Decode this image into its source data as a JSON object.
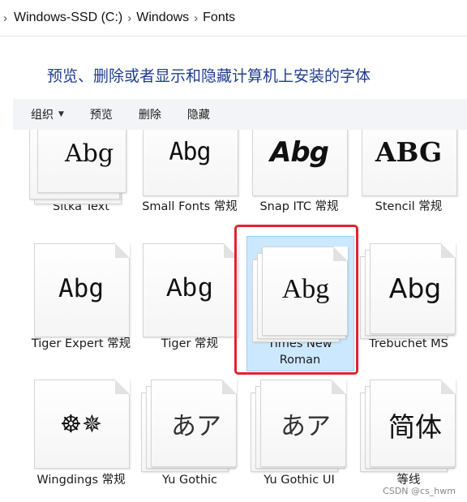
{
  "breadcrumb": {
    "items": [
      "Windows-SSD (C:)",
      "Windows",
      "Fonts"
    ]
  },
  "header": {
    "title": "预览、删除或者显示和隐藏计算机上安装的字体"
  },
  "toolbar": {
    "organize": "组织",
    "preview": "预览",
    "delete": "删除",
    "hide": "隐藏"
  },
  "fonts": [
    {
      "name": "Sitka Text",
      "sample": "Abg",
      "stacked": true
    },
    {
      "name": "Small Fonts 常规",
      "sample": "Abg",
      "stacked": false
    },
    {
      "name": "Snap ITC 常规",
      "sample": "Abg",
      "stacked": false
    },
    {
      "name": "Stencil 常规",
      "sample": "ABG",
      "stacked": false
    },
    {
      "name": "Tiger Expert 常规",
      "sample": "Abg",
      "stacked": false
    },
    {
      "name": "Tiger 常规",
      "sample": "Abg",
      "stacked": false
    },
    {
      "name": "Times New Roman",
      "sample": "Abg",
      "stacked": true,
      "selected": true
    },
    {
      "name": "Trebuchet MS",
      "sample": "Abg",
      "stacked": true
    },
    {
      "name": "Wingdings 常规",
      "sample": "☸✵",
      "stacked": false
    },
    {
      "name": "Yu Gothic",
      "sample": "あア",
      "stacked": true
    },
    {
      "name": "Yu Gothic UI",
      "sample": "あア",
      "stacked": true
    },
    {
      "name": "等线",
      "sample": "简体",
      "stacked": true
    }
  ],
  "watermark": "CSDN @cs_hwm",
  "colors": {
    "title": "#1e3d8f",
    "selection_fill": "#cce8ff",
    "annotation_red": "#e3242b"
  }
}
